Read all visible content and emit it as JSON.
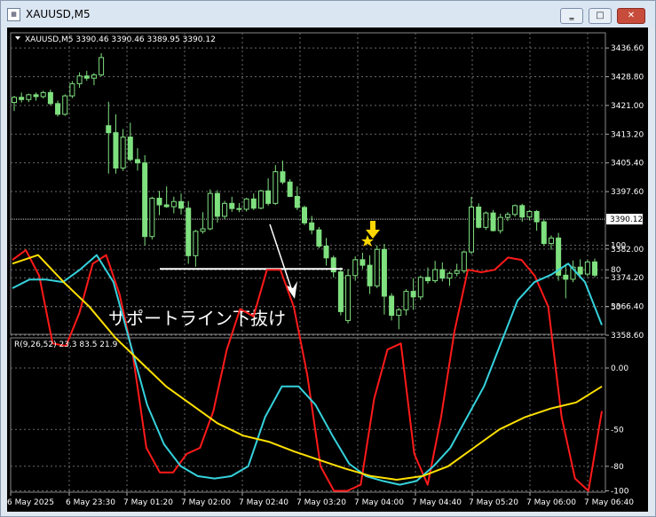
{
  "window": {
    "title": "XAUUSD,M5",
    "icon": "chart-window-icon",
    "buttons": {
      "minimize": "minimize-icon",
      "maximize": "maximize-icon",
      "close": "close-icon"
    }
  },
  "header": {
    "text": "XAUUSD,M5  3390.46 3390.46 3389.95 3390.12"
  },
  "price_labels": [
    "3436.60",
    "3428.80",
    "3421.00",
    "3413.20",
    "3405.40",
    "3397.60",
    "3382.00",
    "3374.20",
    "3366.40",
    "3358.60"
  ],
  "current_price": "3390.12",
  "indicator": {
    "label": "R(9,26,52) 23.3 83.5 21.9",
    "levels": [
      "100",
      "80",
      "50",
      "0.00",
      "-50",
      "-80",
      "-100"
    ]
  },
  "time_labels": [
    "6 May 2025",
    "6 May 23:30",
    "7 May 01:20",
    "7 May 02:00",
    "7 May 02:40",
    "7 May 03:20",
    "7 May 04:00",
    "7 May 04:40",
    "7 May 05:20",
    "7 May 06:00",
    "7 May 06:40"
  ],
  "annotation": {
    "text": "サポートライン下抜け"
  },
  "colors": {
    "background": "#000000",
    "grid": "#6a6a6a",
    "bull": "#7fe07f",
    "text": "#ffffff",
    "fast": "#ff1a1a",
    "mid": "#35d2dc",
    "slow": "#ffe000",
    "arrow": "#ffd700"
  },
  "chart_data": {
    "type": "candlestick",
    "price_axis": [
      3358.6,
      3440.0
    ],
    "candles": [
      [
        3421.8,
        3423.6,
        3419.5,
        3423.2
      ],
      [
        3423.2,
        3424.5,
        3421.8,
        3422.6
      ],
      [
        3422.6,
        3424.2,
        3421.9,
        3423.9
      ],
      [
        3423.9,
        3424.5,
        3422.3,
        3423.4
      ],
      [
        3423.4,
        3425.0,
        3422.9,
        3424.5
      ],
      [
        3424.5,
        3425.3,
        3421.0,
        3421.5
      ],
      [
        3421.5,
        3422.3,
        3418.0,
        3418.6
      ],
      [
        3418.6,
        3424.0,
        3418.2,
        3423.6
      ],
      [
        3423.6,
        3427.6,
        3423.0,
        3426.9
      ],
      [
        3426.9,
        3430.0,
        3425.8,
        3429.0
      ],
      [
        3429.0,
        3430.4,
        3427.7,
        3428.4
      ],
      [
        3428.4,
        3429.8,
        3426.5,
        3429.3
      ],
      [
        3429.3,
        3435.2,
        3428.9,
        3434.0
      ],
      [
        3415.5,
        3422.0,
        3402.5,
        3413.6
      ],
      [
        3413.6,
        3418.6,
        3402.5,
        3404.0
      ],
      [
        3404.0,
        3414.6,
        3403.2,
        3412.4
      ],
      [
        3412.4,
        3416.3,
        3405.8,
        3406.3
      ],
      [
        3406.3,
        3409.4,
        3403.3,
        3405.4
      ],
      [
        3405.4,
        3407.5,
        3383.0,
        3385.4
      ],
      [
        3385.4,
        3396.2,
        3384.6,
        3395.8
      ],
      [
        3395.8,
        3397.8,
        3391.2,
        3394.0
      ],
      [
        3394.0,
        3399.0,
        3393.2,
        3393.5
      ],
      [
        3393.5,
        3396.2,
        3391.7,
        3394.9
      ],
      [
        3394.9,
        3397.1,
        3391.4,
        3393.1
      ],
      [
        3393.1,
        3395.0,
        3378.0,
        3380.2
      ],
      [
        3380.2,
        3387.2,
        3377.2,
        3386.8
      ],
      [
        3386.8,
        3392.0,
        3386.2,
        3387.5
      ],
      [
        3387.5,
        3398.2,
        3387.1,
        3397.1
      ],
      [
        3397.1,
        3398.0,
        3389.2,
        3390.9
      ],
      [
        3390.9,
        3395.1,
        3390.2,
        3394.4
      ],
      [
        3394.4,
        3396.2,
        3392.1,
        3393.0
      ],
      [
        3393.0,
        3394.5,
        3392.0,
        3392.8
      ],
      [
        3392.8,
        3395.9,
        3392.2,
        3395.6
      ],
      [
        3395.6,
        3397.1,
        3392.6,
        3393.1
      ],
      [
        3393.1,
        3398.1,
        3392.8,
        3397.8
      ],
      [
        3397.8,
        3401.2,
        3393.8,
        3394.4
      ],
      [
        3394.4,
        3404.8,
        3394.0,
        3403.0
      ],
      [
        3403.0,
        3406.0,
        3399.6,
        3400.2
      ],
      [
        3400.2,
        3401.0,
        3396.1,
        3396.3
      ],
      [
        3396.3,
        3399.0,
        3392.6,
        3393.3
      ],
      [
        3393.3,
        3393.8,
        3388.5,
        3389.1
      ],
      [
        3389.1,
        3391.0,
        3386.0,
        3387.2
      ],
      [
        3387.2,
        3388.0,
        3382.2,
        3382.8
      ],
      [
        3382.8,
        3385.0,
        3377.5,
        3379.6
      ],
      [
        3379.6,
        3380.2,
        3374.3,
        3375.8
      ],
      [
        3375.8,
        3377.0,
        3364.0,
        3365.0
      ],
      [
        3362.6,
        3376.6,
        3361.8,
        3374.8
      ],
      [
        3374.8,
        3380.0,
        3373.4,
        3379.1
      ],
      [
        3379.1,
        3381.0,
        3376.6,
        3377.6
      ],
      [
        3377.6,
        3380.3,
        3369.8,
        3372.0
      ],
      [
        3372.0,
        3383.0,
        3371.4,
        3381.9
      ],
      [
        3381.9,
        3383.4,
        3364.2,
        3369.2
      ],
      [
        3369.2,
        3370.0,
        3362.6,
        3364.0
      ],
      [
        3364.0,
        3366.0,
        3360.2,
        3365.5
      ],
      [
        3365.5,
        3371.1,
        3364.0,
        3370.5
      ],
      [
        3370.5,
        3374.1,
        3365.5,
        3369.0
      ],
      [
        3369.0,
        3374.8,
        3368.2,
        3374.3
      ],
      [
        3374.3,
        3377.0,
        3372.6,
        3373.4
      ],
      [
        3373.4,
        3378.8,
        3372.8,
        3376.4
      ],
      [
        3376.4,
        3378.4,
        3373.2,
        3374.1
      ],
      [
        3374.1,
        3375.9,
        3372.0,
        3375.4
      ],
      [
        3375.4,
        3378.0,
        3374.6,
        3376.1
      ],
      [
        3376.1,
        3381.6,
        3375.4,
        3381.2
      ],
      [
        3381.2,
        3396.2,
        3380.6,
        3393.4
      ],
      [
        3393.4,
        3394.4,
        3387.6,
        3387.9
      ],
      [
        3387.9,
        3392.2,
        3387.2,
        3391.8
      ],
      [
        3391.8,
        3392.6,
        3386.8,
        3387.0
      ],
      [
        3387.0,
        3391.6,
        3386.2,
        3390.6
      ],
      [
        3390.6,
        3392.0,
        3389.6,
        3391.4
      ],
      [
        3391.4,
        3394.1,
        3390.8,
        3393.8
      ],
      [
        3393.8,
        3394.3,
        3389.4,
        3390.7
      ],
      [
        3390.7,
        3392.6,
        3389.8,
        3392.2
      ],
      [
        3392.2,
        3392.6,
        3387.0,
        3389.4
      ],
      [
        3389.4,
        3390.0,
        3382.8,
        3383.5
      ],
      [
        3383.5,
        3385.7,
        3381.8,
        3385.0
      ],
      [
        3385.0,
        3386.4,
        3373.4,
        3374.9
      ],
      [
        3374.9,
        3378.0,
        3368.6,
        3373.8
      ],
      [
        3373.8,
        3378.9,
        3373.0,
        3377.1
      ],
      [
        3377.1,
        3379.2,
        3374.4,
        3375.2
      ],
      [
        3375.2,
        3379.0,
        3374.6,
        3378.5
      ],
      [
        3378.5,
        3379.4,
        3374.3,
        3374.9
      ]
    ],
    "indicator_series": [
      {
        "name": "fast",
        "values": [
          88,
          96,
          75,
          20,
          18,
          45,
          85,
          92,
          60,
          10,
          -65,
          -85,
          -85,
          -70,
          -65,
          -35,
          15,
          48,
          42,
          80,
          80,
          50,
          -5,
          -80,
          -100,
          -100,
          -95,
          -25,
          15,
          20,
          -70,
          -95,
          -40,
          30,
          80,
          78,
          80,
          90,
          88,
          75,
          50,
          -40,
          -90,
          -100,
          -35
        ]
      },
      {
        "name": "mid",
        "values": [
          65,
          72,
          72,
          70,
          80,
          92,
          70,
          20,
          -30,
          -62,
          -80,
          -88,
          -90,
          -88,
          -80,
          -40,
          -15,
          -15,
          -30,
          -55,
          -78,
          -88,
          -92,
          -95,
          -92,
          -80,
          -65,
          -40,
          -15,
          20,
          55,
          70,
          76,
          85,
          70,
          35
        ]
      },
      {
        "name": "slow",
        "values": [
          85,
          92,
          70,
          50,
          25,
          5,
          -15,
          -30,
          -45,
          -55,
          -60,
          -68,
          -75,
          -82,
          -88,
          -91,
          -88,
          -80,
          -65,
          -50,
          -40,
          -33,
          -28,
          -15
        ]
      }
    ],
    "support_line": 3376.6
  }
}
